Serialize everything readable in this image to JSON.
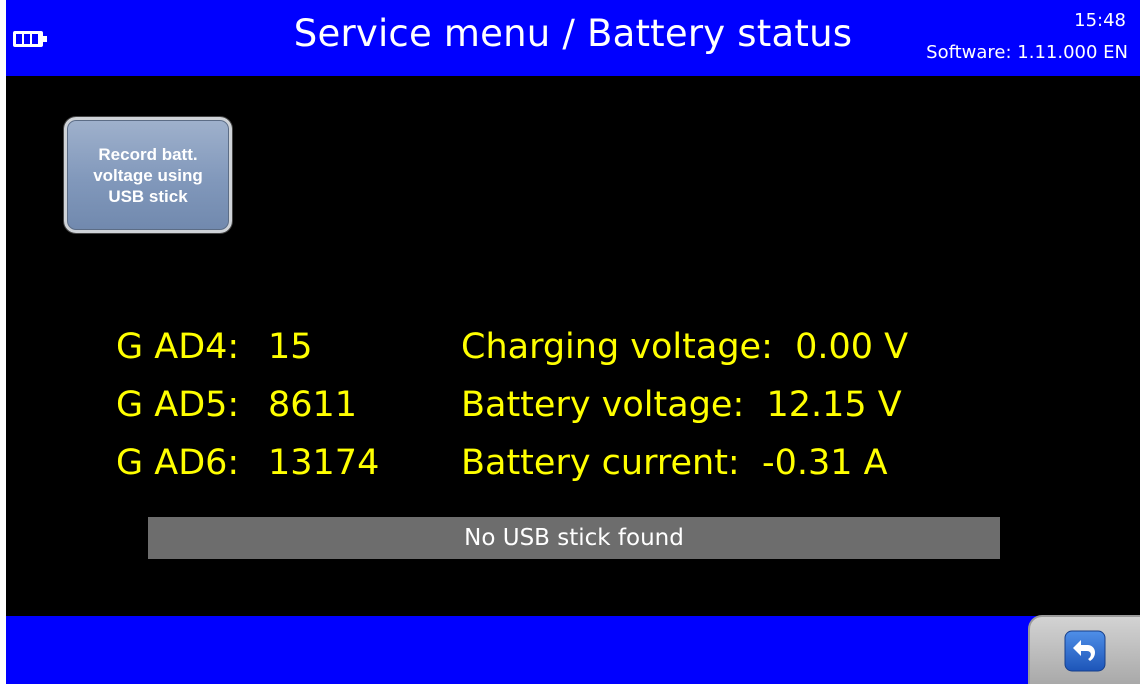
{
  "header": {
    "title": "Service menu / Battery status",
    "time": "15:48",
    "software": "Software: 1.11.000 EN",
    "battery_icon": "battery-icon"
  },
  "record_button": {
    "label": "Record batt. voltage using USB stick"
  },
  "readings": [
    {
      "ad_label": "G AD4:",
      "ad_value": "15",
      "measure": "Charging voltage:  0.00 V"
    },
    {
      "ad_label": "G AD5:",
      "ad_value": "8611",
      "measure": "Battery voltage:  12.15 V"
    },
    {
      "ad_label": "G AD6:",
      "ad_value": "13174",
      "measure": "Battery current:  -0.31 A"
    }
  ],
  "status": {
    "message": "No USB stick found"
  },
  "footer": {
    "back_icon": "back-arrow-icon"
  },
  "colors": {
    "bar_blue": "#0000ff",
    "value_yellow": "#ffff00",
    "background": "#000000",
    "status_gray": "#6d6d6d"
  }
}
